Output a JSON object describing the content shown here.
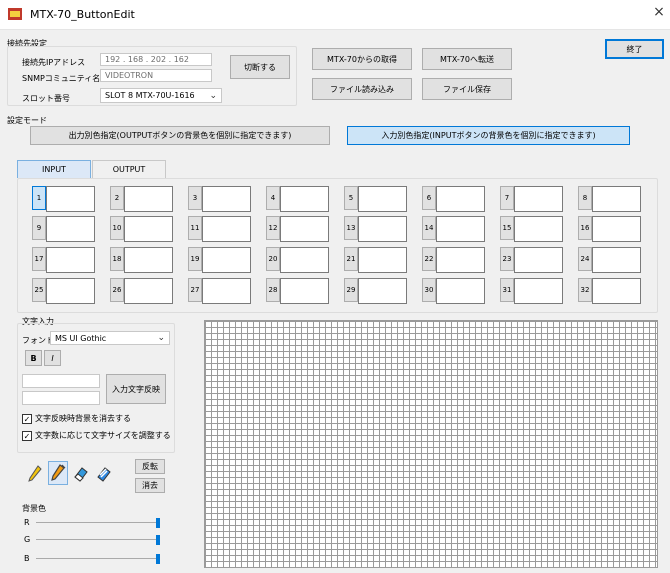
{
  "window": {
    "title": "MTX-70_ButtonEdit",
    "close_glyph": "×"
  },
  "connection": {
    "group_label": "接続先設定",
    "ip_label": "接続先IPアドレス",
    "ip_value": "192 . 168 . 202 . 162",
    "snmp_label": "SNMPコミュニティ名",
    "snmp_value": "VIDEOTRON",
    "slot_label": "スロット番号",
    "slot_value": "SLOT 8  MTX-70U-1616",
    "disconnect_label": "切断する"
  },
  "actions": {
    "fetch_label": "MTX-70からの取得",
    "transfer_label": "MTX-70へ転送",
    "load_label": "ファイル読み込み",
    "save_label": "ファイル保存",
    "exit_label": "終了"
  },
  "mode": {
    "group_label": "設定モード",
    "output_mode_label": "出力別色指定(OUTPUTボタンの背景色を個別に指定できます)",
    "input_mode_label": "入力別色指定(INPUTボタンの背景色を個別に指定できます)"
  },
  "tabs": {
    "input_label": "INPUT",
    "output_label": "OUTPUT"
  },
  "buttons": {
    "row1": [
      "1",
      "2",
      "3",
      "4",
      "5",
      "6",
      "7",
      "8"
    ],
    "row2": [
      "9",
      "10",
      "11",
      "12",
      "13",
      "14",
      "15",
      "16"
    ],
    "row3": [
      "17",
      "18",
      "19",
      "20",
      "21",
      "22",
      "23",
      "24"
    ],
    "row4": [
      "25",
      "26",
      "27",
      "28",
      "29",
      "30",
      "31",
      "32"
    ]
  },
  "text_input": {
    "group_label": "文字入力",
    "font_label": "フォント",
    "font_value": "MS UI Gothic",
    "bold_label": "B",
    "italic_label": "I",
    "line1_value": "",
    "line2_value": "",
    "apply_label": "入力文字反映",
    "clear_bg_label": "文字反映時背景を消去する",
    "clear_bg_checked": "✓",
    "autosize_label": "文字数に応じて文字サイズを調整する",
    "autosize_checked": "✓"
  },
  "tools": {
    "pencil_icon": "pencil-icon",
    "pen_icon": "pen-icon",
    "eraser_icon": "eraser-icon",
    "fill_eraser_icon": "fill-eraser-icon",
    "invert_label": "反転",
    "clear_label": "消去"
  },
  "background_color": {
    "group_label": "背景色",
    "r_label": "R",
    "g_label": "G",
    "b_label": "B",
    "r_level": 1.0,
    "g_level": 1.0,
    "b_level": 1.0
  },
  "colors": {
    "accent": "#0078d7",
    "selected_bg": "#cce4f7"
  }
}
